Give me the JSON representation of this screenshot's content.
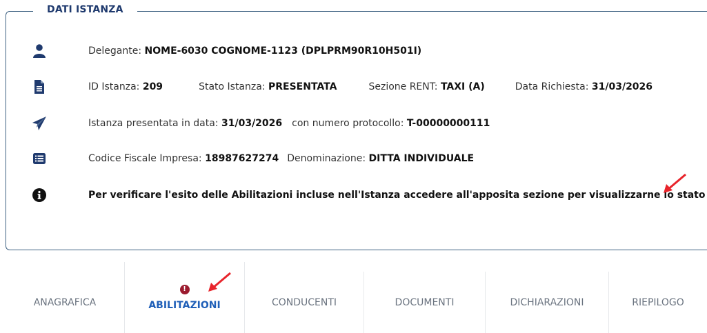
{
  "section_title": "DATI ISTANZA",
  "rows": {
    "delegante": {
      "label": "Delegante:",
      "value": "NOME-6030 COGNOME-1123 (DPLPRM90R10H501I)"
    },
    "id_istanza": {
      "label": "ID Istanza:",
      "value": "209"
    },
    "stato_istanza": {
      "label": "Stato Istanza:",
      "value": "PRESENTATA"
    },
    "sezione_rent": {
      "label": "Sezione RENT:",
      "value": "TAXI (A)"
    },
    "data_richiesta": {
      "label": "Data Richiesta:",
      "value": "31/03/2026"
    },
    "presentata": {
      "label": "Istanza presentata in data:",
      "value": "31/03/2026"
    },
    "protocollo": {
      "label": "con numero protocollo:",
      "value": "T-00000000111"
    },
    "codice_fiscale": {
      "label": "Codice Fiscale Impresa:",
      "value": "18987627274"
    },
    "denominazione": {
      "label": "Denominazione:",
      "value": "DITTA INDIVIDUALE"
    },
    "info": "Per verificare l'esito delle Abilitazioni incluse nell'Istanza accedere all'apposita sezione per visualizzarne lo stato"
  },
  "tabs": [
    {
      "label": "ANAGRAFICA"
    },
    {
      "label": "ABILITAZIONI",
      "active": true,
      "badge": "!"
    },
    {
      "label": "CONDUCENTI"
    },
    {
      "label": "DOCUMENTI"
    },
    {
      "label": "DICHIARAZIONI"
    },
    {
      "label": "RIEPILOGO"
    }
  ],
  "colors": {
    "icon": "#1f3a6e",
    "active_tab": "#1f5fb8",
    "error_badge": "#9b1b2e",
    "annotation_arrow": "#e8242b"
  }
}
